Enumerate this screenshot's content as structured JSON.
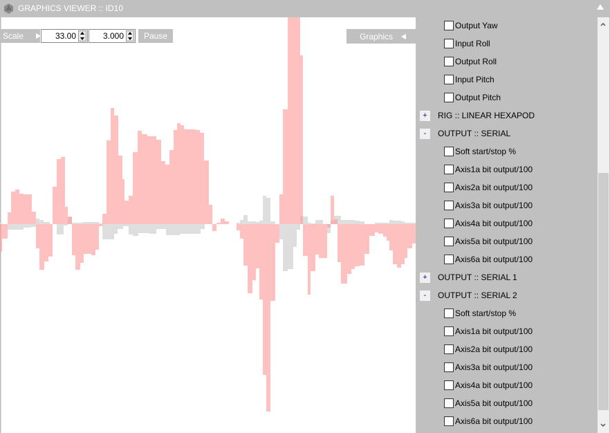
{
  "window": {
    "title": "GRAPHICS VIEWER :: ID10"
  },
  "toolbar": {
    "scale_label": "Scale",
    "scale_value": "33.00",
    "offset_value": "3.000",
    "pause_label": "Pause",
    "graphics_label": "Graphics"
  },
  "panel": {
    "items": [
      {
        "type": "check",
        "label": "Output Yaw",
        "checked": false
      },
      {
        "type": "check",
        "label": "Input Roll",
        "checked": false
      },
      {
        "type": "check",
        "label": "Output Roll",
        "checked": false
      },
      {
        "type": "check",
        "label": "Input Pitch",
        "checked": false
      },
      {
        "type": "check",
        "label": "Output Pitch",
        "checked": false
      },
      {
        "type": "group",
        "label": "RIG :: LINEAR HEXAPOD",
        "toggle": "+"
      },
      {
        "type": "group",
        "label": "OUTPUT :: SERIAL",
        "toggle": "-"
      },
      {
        "type": "check",
        "label": "Soft start/stop %",
        "checked": false
      },
      {
        "type": "check",
        "label": "Axis1a bit output/100",
        "checked": false
      },
      {
        "type": "check",
        "label": "Axis2a bit output/100",
        "checked": false
      },
      {
        "type": "check",
        "label": "Axis3a bit output/100",
        "checked": false
      },
      {
        "type": "check",
        "label": "Axis4a bit output/100",
        "checked": false
      },
      {
        "type": "check",
        "label": "Axis5a bit output/100",
        "checked": false
      },
      {
        "type": "check",
        "label": "Axis6a bit output/100",
        "checked": false
      },
      {
        "type": "group",
        "label": "OUTPUT :: SERIAL 1",
        "toggle": "+"
      },
      {
        "type": "group",
        "label": "OUTPUT :: SERIAL 2",
        "toggle": "-"
      },
      {
        "type": "check",
        "label": "Soft start/stop %",
        "checked": false
      },
      {
        "type": "check",
        "label": "Axis1a bit output/100",
        "checked": false
      },
      {
        "type": "check",
        "label": "Axis2a bit output/100",
        "checked": false
      },
      {
        "type": "check",
        "label": "Axis3a bit output/100",
        "checked": false
      },
      {
        "type": "check",
        "label": "Axis4a bit output/100",
        "checked": false
      },
      {
        "type": "check",
        "label": "Axis5a bit output/100",
        "checked": false
      },
      {
        "type": "check",
        "label": "Axis6a bit output/100",
        "checked": false
      }
    ]
  },
  "scroll": {
    "position_fraction": 0.4,
    "visible_fraction": 0.6
  },
  "colors": {
    "pink": "#ff9a9a",
    "gray": "#dedede"
  },
  "chart_data": {
    "type": "bar",
    "xlim": [
      0,
      601
    ],
    "ylim": [
      -302,
      299
    ],
    "series": [
      {
        "name": "gray",
        "color": "#dedede",
        "segments": [
          [
            0,
            2
          ],
          [
            3,
            0
          ],
          [
            11,
            -8
          ],
          [
            34,
            -5
          ],
          [
            45,
            -4
          ],
          [
            52,
            8
          ],
          [
            57,
            6
          ],
          [
            63,
            3
          ],
          [
            72,
            0
          ],
          [
            82,
            -15
          ],
          [
            92,
            -2
          ],
          [
            98,
            10
          ],
          [
            104,
            2
          ],
          [
            120,
            3
          ],
          [
            143,
            1
          ],
          [
            148,
            -22
          ],
          [
            165,
            -14
          ],
          [
            170,
            -7
          ],
          [
            178,
            -3
          ],
          [
            186,
            -15
          ],
          [
            192,
            -17
          ],
          [
            200,
            -13
          ],
          [
            216,
            -14
          ],
          [
            226,
            -7
          ],
          [
            240,
            -16
          ],
          [
            260,
            -14
          ],
          [
            290,
            -7
          ],
          [
            296,
            0
          ],
          [
            342,
            2
          ],
          [
            347,
            6
          ],
          [
            352,
            13
          ],
          [
            358,
            4
          ],
          [
            370,
            3
          ],
          [
            375,
            5
          ],
          [
            380,
            41
          ],
          [
            385,
            38
          ],
          [
            391,
            4
          ],
          [
            398,
            0
          ],
          [
            404,
            -22
          ],
          [
            409,
            -68
          ],
          [
            416,
            -65
          ],
          [
            424,
            -33
          ],
          [
            429,
            -8
          ],
          [
            434,
            12
          ],
          [
            438,
            11
          ],
          [
            445,
            2
          ],
          [
            449,
            1
          ],
          [
            456,
            6
          ],
          [
            467,
            0
          ],
          [
            473,
            -13
          ],
          [
            478,
            5
          ],
          [
            483,
            12
          ],
          [
            493,
            6
          ],
          [
            513,
            5
          ],
          [
            520,
            4
          ],
          [
            527,
            0
          ],
          [
            542,
            2
          ],
          [
            563,
            6
          ],
          [
            568,
            5
          ],
          [
            580,
            4
          ],
          [
            585,
            2
          ],
          [
            596,
            2
          ]
        ]
      },
      {
        "name": "pink",
        "color": "#ff9a9a",
        "segments": [
          [
            0,
            -40
          ],
          [
            3,
            -21
          ],
          [
            11,
            17
          ],
          [
            16,
            47
          ],
          [
            22,
            50
          ],
          [
            28,
            44
          ],
          [
            34,
            43
          ],
          [
            46,
            18
          ],
          [
            52,
            -35
          ],
          [
            57,
            -66
          ],
          [
            64,
            -54
          ],
          [
            70,
            -47
          ],
          [
            76,
            54
          ],
          [
            82,
            94
          ],
          [
            88,
            97
          ],
          [
            94,
            25
          ],
          [
            98,
            11
          ],
          [
            104,
            -45
          ],
          [
            109,
            -66
          ],
          [
            116,
            -56
          ],
          [
            121,
            -43
          ],
          [
            132,
            -45
          ],
          [
            138,
            -37
          ],
          [
            143,
            -3
          ],
          [
            148,
            15
          ],
          [
            154,
            121
          ],
          [
            160,
            168
          ],
          [
            165,
            157
          ],
          [
            171,
            99
          ],
          [
            177,
            65
          ],
          [
            180,
            34
          ],
          [
            186,
            41
          ],
          [
            192,
            104
          ],
          [
            199,
            135
          ],
          [
            205,
            130
          ],
          [
            213,
            127
          ],
          [
            226,
            122
          ],
          [
            233,
            91
          ],
          [
            239,
            86
          ],
          [
            245,
            107
          ],
          [
            251,
            136
          ],
          [
            256,
            146
          ],
          [
            261,
            143
          ],
          [
            266,
            137
          ],
          [
            283,
            136
          ],
          [
            289,
            132
          ],
          [
            295,
            92
          ],
          [
            302,
            28
          ],
          [
            307,
            -10
          ],
          [
            313,
            2
          ],
          [
            319,
            8
          ],
          [
            325,
            4
          ],
          [
            331,
            0
          ],
          [
            342,
            -9
          ],
          [
            347,
            -21
          ],
          [
            352,
            -60
          ],
          [
            358,
            -100
          ],
          [
            365,
            -81
          ],
          [
            370,
            -64
          ],
          [
            375,
            -109
          ],
          [
            380,
            -218
          ],
          [
            385,
            -271
          ],
          [
            391,
            -111
          ],
          [
            398,
            -27
          ],
          [
            404,
            43
          ],
          [
            409,
            166
          ],
          [
            416,
            320
          ],
          [
            434,
            244
          ],
          [
            438,
            -46
          ],
          [
            445,
            -102
          ],
          [
            449,
            -68
          ],
          [
            456,
            -44
          ],
          [
            461,
            -49
          ],
          [
            473,
            -5
          ],
          [
            478,
            41
          ],
          [
            483,
            7
          ],
          [
            488,
            -55
          ],
          [
            493,
            -86
          ],
          [
            502,
            -72
          ],
          [
            508,
            -65
          ],
          [
            513,
            -61
          ],
          [
            520,
            -60
          ],
          [
            527,
            -43
          ],
          [
            534,
            -17
          ],
          [
            542,
            -12
          ],
          [
            547,
            -14
          ],
          [
            554,
            -18
          ],
          [
            559,
            -24
          ],
          [
            563,
            -38
          ],
          [
            568,
            -58
          ],
          [
            574,
            -63
          ],
          [
            580,
            -58
          ],
          [
            585,
            -49
          ],
          [
            589,
            -35
          ],
          [
            596,
            -28
          ]
        ]
      }
    ]
  }
}
